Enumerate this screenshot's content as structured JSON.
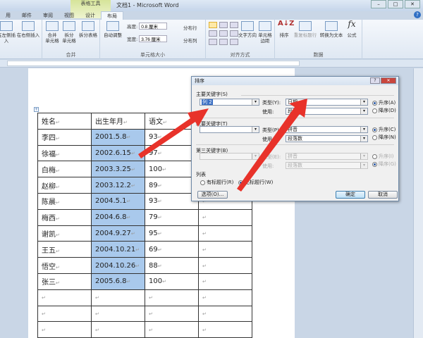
{
  "window": {
    "title": "文档1 - Microsoft Word",
    "context_tab": "表格工具",
    "controls": [
      "–",
      "□",
      "✕"
    ]
  },
  "tabs": [
    "用",
    "邮件",
    "审阅",
    "视图",
    "设计",
    "布局"
  ],
  "ribbon": {
    "rows_cols": {
      "insert_left": "在左侧插入",
      "insert_right": "在右侧插入"
    },
    "merge": {
      "label": "合并",
      "merge_cells": "合并\n单元格",
      "split_cells": "拆分\n单元格",
      "split_table": "拆分表格"
    },
    "cell_size": {
      "label": "单元格大小",
      "autofit": "自动调整",
      "height_label": "高度:",
      "height_value": "0.8 厘米",
      "width_label": "宽度:",
      "width_value": "3.76 厘米",
      "dist_rows": "分布行",
      "dist_cols": "分布列"
    },
    "alignment": {
      "label": "对齐方式",
      "text_direction": "文字方向",
      "cell_margins": "单元格\n边距"
    },
    "data": {
      "label": "数据",
      "sort": "排序",
      "repeat_header": "重复标题行",
      "convert": "转换为文本",
      "formula": "公式"
    }
  },
  "table": {
    "headers": [
      "姓名",
      "出生年月",
      "语文",
      ""
    ],
    "rows": [
      [
        "李四",
        "2001.5.8",
        "93"
      ],
      [
        "徐福",
        "2002.6.15",
        "97"
      ],
      [
        "白梅",
        "2003.3.25",
        "100"
      ],
      [
        "赵柳",
        "2003.12.2",
        "89"
      ],
      [
        "陈晨",
        "2004.5.1",
        "93"
      ],
      [
        "梅西",
        "2004.6.8",
        "79"
      ],
      [
        "谢凯",
        "2004.9.27",
        "95"
      ],
      [
        "王五",
        "2004.10.21",
        "69"
      ],
      [
        "悟空",
        "2004.10.26",
        "88"
      ],
      [
        "张三",
        "2005.6.8",
        "100"
      ],
      [
        "",
        "",
        ""
      ],
      [
        "",
        "",
        ""
      ],
      [
        "",
        "",
        ""
      ]
    ]
  },
  "dialog": {
    "title": "排序",
    "primary": {
      "label": "主要关键字(S)",
      "value": "列 2",
      "type_label": "类型(Y):",
      "type_value": "日期",
      "using_label": "使用:",
      "using_value": "段落数",
      "asc": "升序(A)",
      "desc": "降序(D)"
    },
    "secondary": {
      "label": "次要关键字(T)",
      "value": "",
      "type_label": "类型(P):",
      "type_value": "拼音",
      "using_label": "使用:",
      "using_value": "段落数",
      "asc": "升序(C)",
      "desc": "降序(N)"
    },
    "third": {
      "label": "第三关键字(B)",
      "value": "",
      "type_label": "类型(E):",
      "type_value": "拼音",
      "using_label": "使用:",
      "using_value": "段落数",
      "asc": "升序(I)",
      "desc": "降序(G)"
    },
    "list": {
      "label": "列表",
      "has_header": "有标题行(R)",
      "no_header": "无标题行(W)"
    },
    "options": "选项(O)...",
    "ok": "确定",
    "cancel": "取消"
  },
  "colors": {
    "selection": "#a9c9ec",
    "arrow": "#e8322a"
  }
}
